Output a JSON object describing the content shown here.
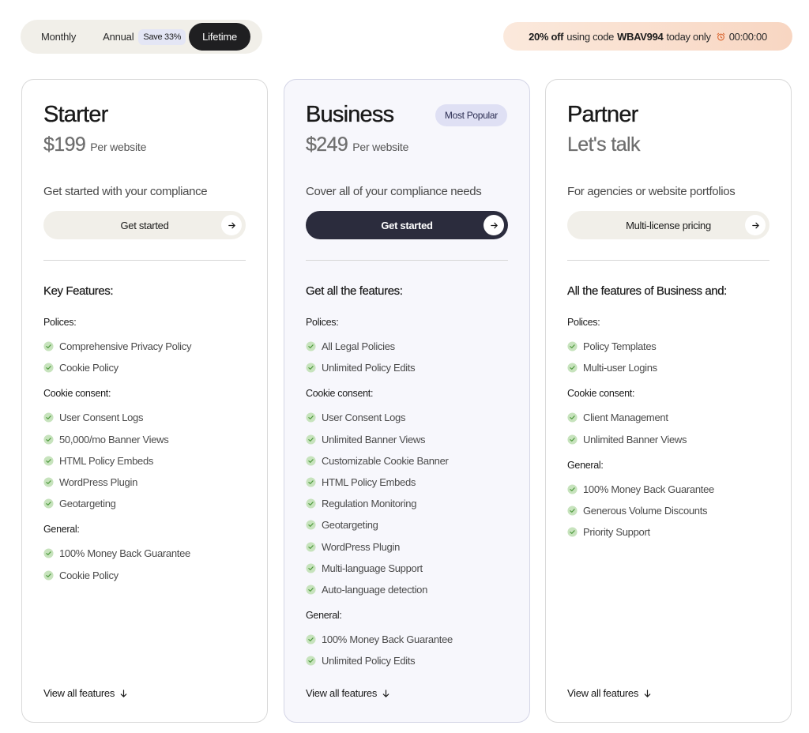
{
  "billing": {
    "monthly": "Monthly",
    "annual": "Annual",
    "save_badge": "Save 33%",
    "lifetime": "Lifetime",
    "selected": "Lifetime"
  },
  "promo": {
    "discount": "20% off",
    "text_using_code": "using code",
    "code": "WBAV994",
    "text_today_only": "today only",
    "timer": "00:00:00"
  },
  "colors": {
    "accent_dark": "#2b2c3d",
    "check_green": "#7bbd6b",
    "popular_badge_bg": "#dfe0f4"
  },
  "plans": [
    {
      "name": "Starter",
      "price": "$199",
      "per": "Per website",
      "tagline": "Get started with your compliance",
      "cta": "Get started",
      "features_title": "Key Features:",
      "groups": [
        {
          "label": "Polices:",
          "items": [
            "Comprehensive Privacy Policy",
            "Cookie Policy"
          ]
        },
        {
          "label": "Cookie consent:",
          "items": [
            "User Consent Logs",
            "50,000/mo Banner Views",
            "HTML Policy Embeds",
            "WordPress Plugin",
            "Geotargeting"
          ]
        },
        {
          "label": "General:",
          "items": [
            "100% Money Back Guarantee",
            "Cookie Policy"
          ]
        }
      ],
      "view_all": "View all features"
    },
    {
      "name": "Business",
      "badge": "Most Popular",
      "price": "$249",
      "per": "Per website",
      "tagline": "Cover all of your compliance needs",
      "cta": "Get started",
      "features_title": "Get all the features:",
      "groups": [
        {
          "label": "Polices:",
          "items": [
            "All Legal Policies",
            "Unlimited Policy Edits"
          ]
        },
        {
          "label": "Cookie consent:",
          "items": [
            "User Consent Logs",
            "Unlimited Banner Views",
            "Customizable Cookie Banner",
            "HTML Policy Embeds",
            "Regulation Monitoring",
            "Geotargeting",
            "WordPress Plugin",
            "Multi-language Support",
            "Auto-language detection"
          ]
        },
        {
          "label": "General:",
          "items": [
            "100% Money Back Guarantee",
            "Unlimited Policy Edits"
          ]
        }
      ],
      "view_all": "View all features"
    },
    {
      "name": "Partner",
      "price_text": "Let's talk",
      "tagline": "For agencies or website portfolios",
      "cta": "Multi-license pricing",
      "features_title": "All the features of Business and:",
      "groups": [
        {
          "label": "Polices:",
          "items": [
            "Policy Templates",
            "Multi-user Logins"
          ]
        },
        {
          "label": "Cookie consent:",
          "items": [
            "Client Management",
            "Unlimited Banner Views"
          ]
        },
        {
          "label": "General:",
          "items": [
            "100% Money Back Guarantee",
            "Generous Volume Discounts",
            "Priority Support"
          ]
        }
      ],
      "view_all": "View all features"
    }
  ]
}
